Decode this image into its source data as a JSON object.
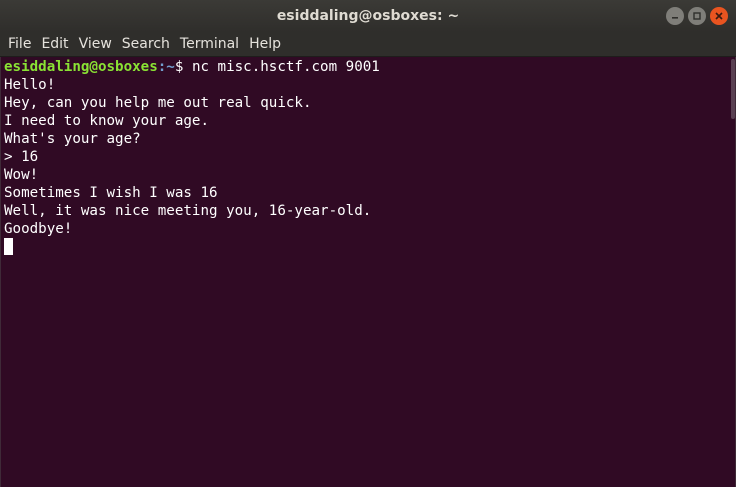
{
  "window": {
    "title": "esiddaling@osboxes: ~"
  },
  "menubar": {
    "items": [
      "File",
      "Edit",
      "View",
      "Search",
      "Terminal",
      "Help"
    ]
  },
  "terminal": {
    "prompt_user": "esiddaling@osboxes",
    "prompt_path": ":~",
    "prompt_symbol": "$ ",
    "command": "nc misc.hsctf.com 9001",
    "output": [
      "Hello!",
      "Hey, can you help me out real quick.",
      "I need to know your age.",
      "What's your age?",
      "> 16",
      "Wow!",
      "Sometimes I wish I was 16",
      "Well, it was nice meeting you, 16-year-old.",
      "Goodbye!"
    ]
  },
  "colors": {
    "terminal_bg": "#300a24",
    "prompt_user": "#8ae234",
    "prompt_path": "#729fcf",
    "close_button": "#e95420"
  },
  "icons": {
    "minimize": "minimize-icon",
    "maximize": "maximize-icon",
    "close": "close-icon"
  }
}
